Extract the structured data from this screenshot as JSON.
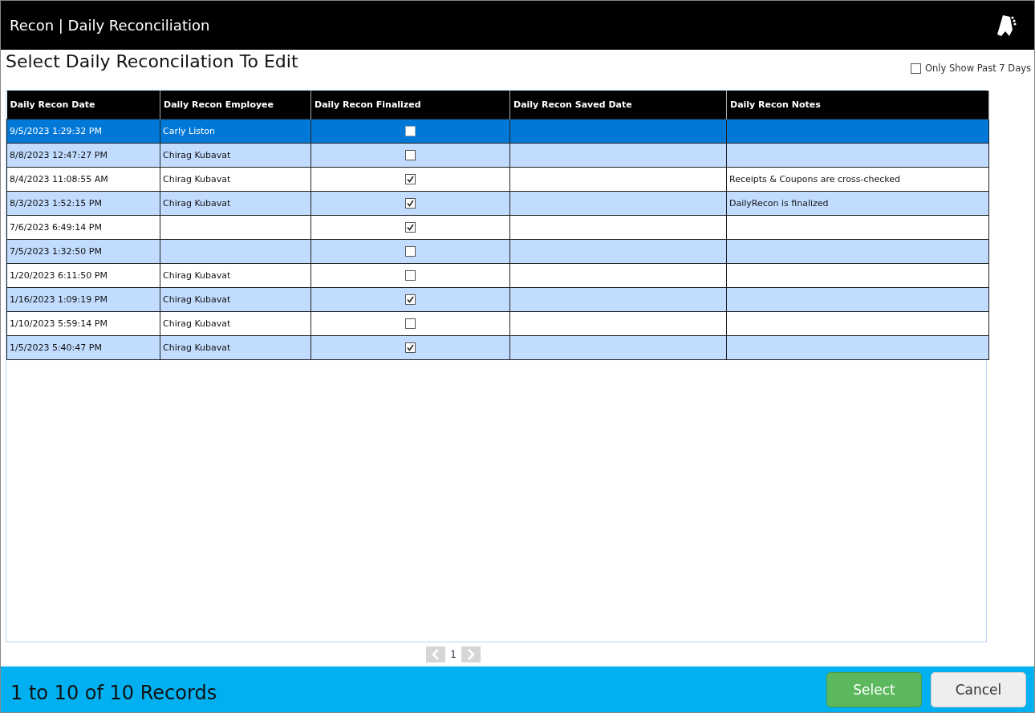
{
  "window": {
    "title": "Recon | Daily Reconciliation"
  },
  "page_title": "Select Daily Reconcilation To Edit",
  "filter": {
    "label": "Only Show Past 7 Days",
    "checked": false
  },
  "table": {
    "columns": [
      "Daily Recon Date",
      "Daily Recon Employee",
      "Daily Recon Finalized",
      "Daily Recon Saved Date",
      "Daily Recon Notes"
    ],
    "rows": [
      {
        "date": "9/5/2023 1:29:32 PM",
        "employee": "Carly Liston",
        "finalized": false,
        "saved_date": "",
        "notes": "",
        "selected": true
      },
      {
        "date": "8/8/2023 12:47:27 PM",
        "employee": "Chirag Kubavat",
        "finalized": false,
        "saved_date": "",
        "notes": "",
        "selected": false
      },
      {
        "date": "8/4/2023 11:08:55 AM",
        "employee": "Chirag Kubavat",
        "finalized": true,
        "saved_date": "",
        "notes": "Receipts & Coupons are cross-checked",
        "selected": false
      },
      {
        "date": "8/3/2023 1:52:15 PM",
        "employee": "Chirag Kubavat",
        "finalized": true,
        "saved_date": "",
        "notes": "DailyRecon is finalized",
        "selected": false
      },
      {
        "date": "7/6/2023 6:49:14 PM",
        "employee": "",
        "finalized": true,
        "saved_date": "",
        "notes": "",
        "selected": false
      },
      {
        "date": "7/5/2023 1:32:50 PM",
        "employee": "",
        "finalized": false,
        "saved_date": "",
        "notes": "",
        "selected": false
      },
      {
        "date": "1/20/2023 6:11:50 PM",
        "employee": "Chirag Kubavat",
        "finalized": false,
        "saved_date": "",
        "notes": "",
        "selected": false
      },
      {
        "date": "1/16/2023 1:09:19 PM",
        "employee": "Chirag Kubavat",
        "finalized": true,
        "saved_date": "",
        "notes": "",
        "selected": false
      },
      {
        "date": "1/10/2023 5:59:14 PM",
        "employee": "Chirag Kubavat",
        "finalized": false,
        "saved_date": "",
        "notes": "",
        "selected": false
      },
      {
        "date": "1/5/2023 5:40:47 PM",
        "employee": "Chirag Kubavat",
        "finalized": true,
        "saved_date": "",
        "notes": "",
        "selected": false
      }
    ]
  },
  "pager": {
    "page": "1"
  },
  "status": "1 to 10 of 10 Records",
  "buttons": [
    {
      "label": "Select",
      "kind": "primary"
    },
    {
      "label": "Cancel",
      "kind": "secondary"
    }
  ]
}
